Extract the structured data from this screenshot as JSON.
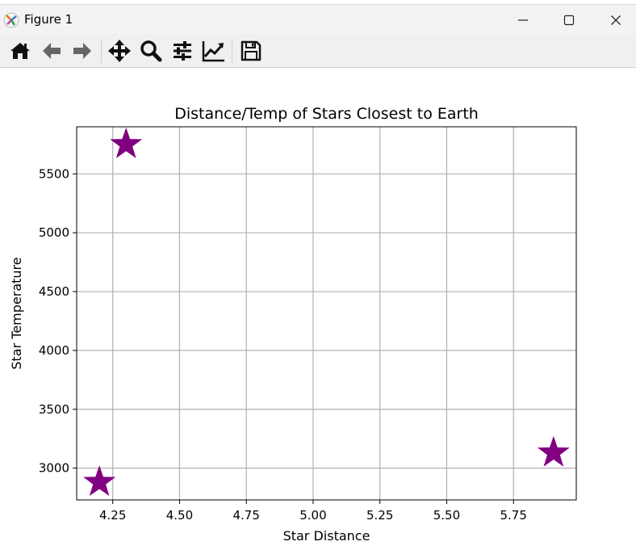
{
  "window": {
    "title": "Figure 1"
  },
  "toolbar": {
    "tools": [
      {
        "name": "home-icon"
      },
      {
        "name": "back-arrow-icon"
      },
      {
        "name": "forward-arrow-icon"
      },
      {
        "name": "pan-move-icon"
      },
      {
        "name": "zoom-magnifier-icon"
      },
      {
        "name": "configure-subplots-icon"
      },
      {
        "name": "edit-axis-line-icon"
      },
      {
        "name": "save-floppy-icon"
      }
    ]
  },
  "colors": {
    "marker": "#800080",
    "grid": "#b0b0b0",
    "axes": "#000000"
  },
  "chart_data": {
    "type": "scatter",
    "title": "Distance/Temp of Stars Closest to Earth",
    "xlabel": "Star Distance",
    "ylabel": "Star Temperature",
    "marker": "star",
    "grid": true,
    "x": [
      4.2,
      4.3,
      5.9
    ],
    "y": [
      2880,
      5750,
      3130
    ],
    "xlim": [
      4.115,
      5.985
    ],
    "ylim": [
      2730,
      5900
    ],
    "xticks": [
      4.25,
      4.5,
      4.75,
      5.0,
      5.25,
      5.5,
      5.75
    ],
    "xtick_labels": [
      "4.25",
      "4.50",
      "4.75",
      "5.00",
      "5.25",
      "5.50",
      "5.75"
    ],
    "yticks": [
      3000,
      3500,
      4000,
      4500,
      5000,
      5500
    ],
    "ytick_labels": [
      "3000",
      "3500",
      "4000",
      "4500",
      "5000",
      "5500"
    ]
  }
}
